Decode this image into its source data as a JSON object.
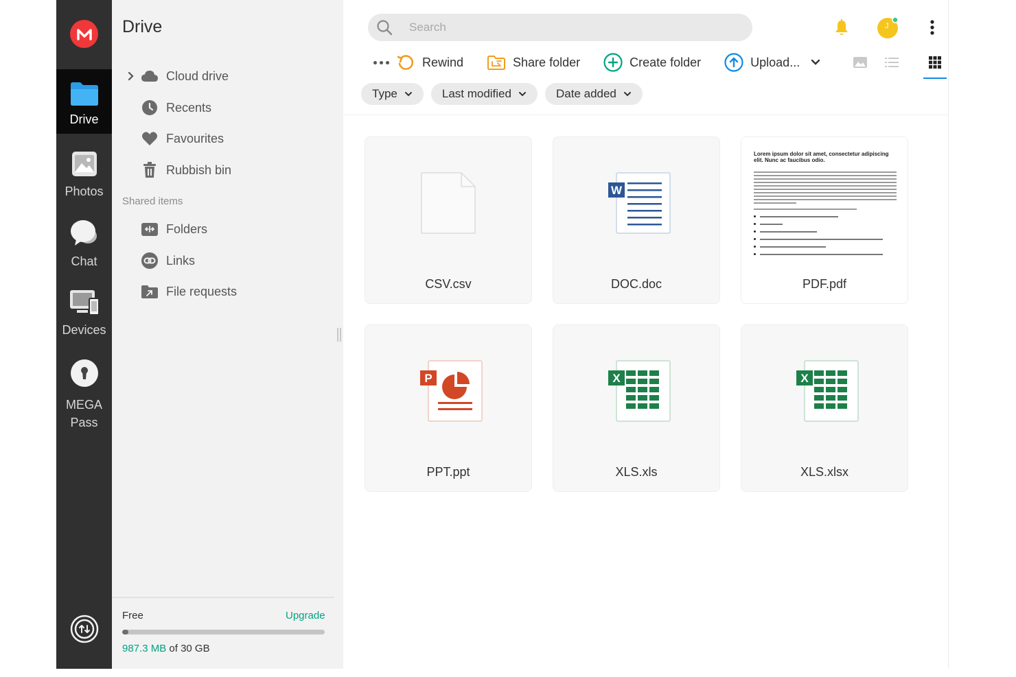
{
  "rail": {
    "items": [
      {
        "label": "Drive",
        "icon": "folder-icon",
        "active": true
      },
      {
        "label": "Photos",
        "icon": "photos-icon",
        "active": false
      },
      {
        "label": "Chat",
        "icon": "chat-icon",
        "active": false
      },
      {
        "label": "Devices",
        "icon": "devices-icon",
        "active": false
      },
      {
        "label": "MEGA",
        "label2": "Pass",
        "icon": "keyhole-icon",
        "active": false
      }
    ],
    "logo_icon": "mega-logo-icon",
    "bottom_icon": "transfer-manager-icon"
  },
  "sidebar": {
    "title": "Drive",
    "items": [
      {
        "label": "Cloud drive",
        "icon": "cloud-icon"
      },
      {
        "label": "Recents",
        "icon": "clock-icon"
      },
      {
        "label": "Favourites",
        "icon": "heart-icon"
      },
      {
        "label": "Rubbish bin",
        "icon": "trash-icon"
      }
    ],
    "shared_section": "Shared items",
    "shared_items": [
      {
        "label": "Folders",
        "icon": "shared-folder-icon"
      },
      {
        "label": "Links",
        "icon": "link-icon"
      },
      {
        "label": "File requests",
        "icon": "file-request-icon"
      }
    ],
    "storage": {
      "plan": "Free",
      "upgrade": "Upgrade",
      "used": "987.3 MB",
      "of_total": " of 30 GB",
      "used_fraction": 0.032
    }
  },
  "header": {
    "search_placeholder": "Search",
    "notification_icon": "bell-icon",
    "avatar_initial": "J",
    "menu_icon": "vertical-dots-icon"
  },
  "toolbar": {
    "rewind": "Rewind",
    "share_folder": "Share folder",
    "create_folder": "Create folder",
    "upload": "Upload..."
  },
  "filters": {
    "type": "Type",
    "last_modified": "Last modified",
    "date_added": "Date added"
  },
  "files": [
    {
      "name": "CSV.csv",
      "kind": "csv"
    },
    {
      "name": "DOC.doc",
      "kind": "doc"
    },
    {
      "name": "PDF.pdf",
      "kind": "pdf"
    },
    {
      "name": "PPT.ppt",
      "kind": "ppt"
    },
    {
      "name": "XLS.xls",
      "kind": "xls"
    },
    {
      "name": "XLS.xlsx",
      "kind": "xlsx"
    }
  ],
  "pdf_preview": {
    "heading": "Lorem ipsum dolor sit amet, consectetur adipiscing elit. Nunc ac faucibus odio."
  },
  "colors": {
    "accent": "#00a382",
    "brand_red": "#f0373a",
    "active_view": "#0f8ae5",
    "doc_blue": "#2b5797",
    "ppt_orange": "#d24726",
    "xls_green": "#1d8049"
  }
}
